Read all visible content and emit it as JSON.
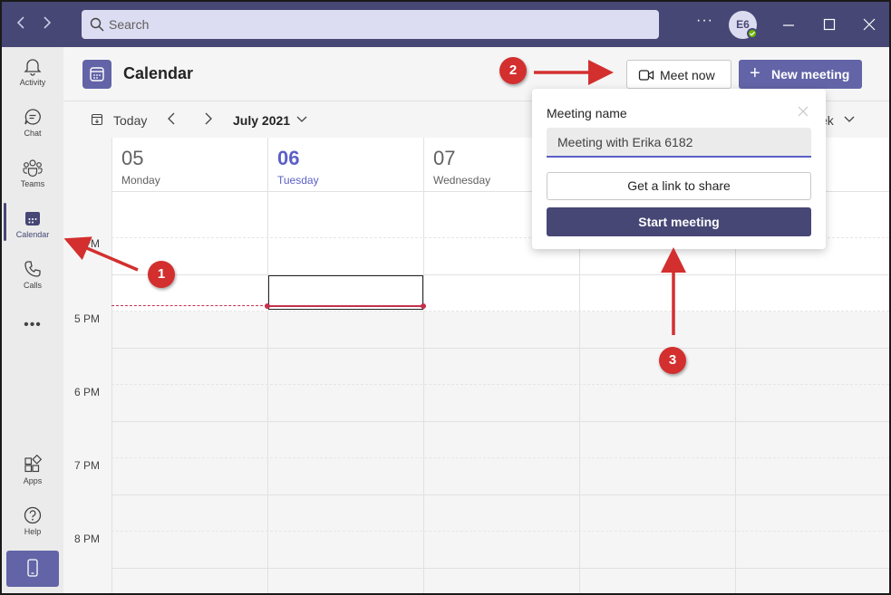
{
  "titlebar": {
    "search_placeholder": "Search",
    "more_label": "···",
    "avatar_initials": "E6",
    "presence_color": "#6bb700"
  },
  "rail": {
    "items": [
      {
        "label": "Activity",
        "icon": "bell-icon"
      },
      {
        "label": "Chat",
        "icon": "chat-icon"
      },
      {
        "label": "Teams",
        "icon": "teams-icon"
      },
      {
        "label": "Calendar",
        "icon": "calendar-icon",
        "active": true
      },
      {
        "label": "Calls",
        "icon": "phone-icon"
      }
    ],
    "more_label": "•••",
    "bottom_items": [
      {
        "label": "Apps",
        "icon": "apps-icon"
      },
      {
        "label": "Help",
        "icon": "help-icon"
      }
    ],
    "mobile_icon": "mobile-icon"
  },
  "header": {
    "title": "Calendar",
    "meet_now_label": "Meet now",
    "new_meeting_label": "New meeting"
  },
  "toolbar": {
    "today_label": "Today",
    "month_label": "July 2021",
    "view_label": "ek"
  },
  "calendar": {
    "days": [
      {
        "num": "05",
        "name": "Monday"
      },
      {
        "num": "06",
        "name": "Tuesday",
        "today": true
      },
      {
        "num": "07",
        "name": "Wednesday"
      },
      {
        "num": "",
        "name": ""
      },
      {
        "num": "",
        "name": ""
      }
    ],
    "time_labels": [
      "4 PM",
      "5 PM",
      "6 PM",
      "7 PM",
      "8 PM"
    ]
  },
  "popup": {
    "title": "Meeting name",
    "meeting_name_value": "Meeting with Erika 6182",
    "link_button_label": "Get a link to share",
    "start_button_label": "Start meeting"
  },
  "annotations": {
    "callout_1": "1",
    "callout_2": "2",
    "callout_3": "3",
    "arrow_color": "#d32f2f"
  },
  "colors": {
    "titlebar": "#464775",
    "accent": "#6264a7",
    "today": "#5b5fc7",
    "now_line": "#c4314b"
  }
}
